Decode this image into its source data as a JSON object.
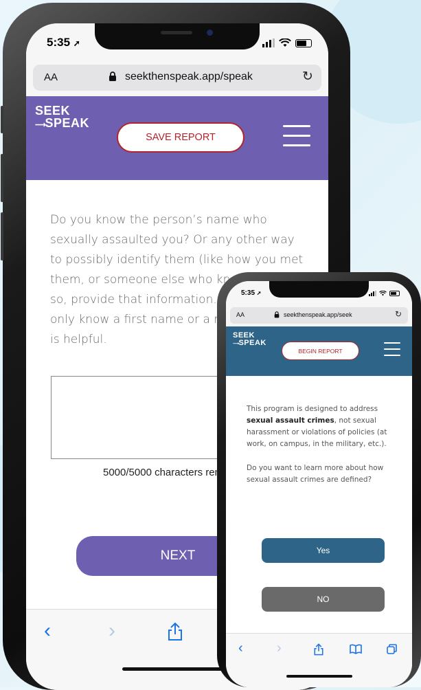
{
  "colors": {
    "big_header": "#6f5fb0",
    "small_header": "#2d6487",
    "save_text": "#b0252a",
    "no_button": "#6a6a6a"
  },
  "big_phone": {
    "status_time": "5:35",
    "url_aa": "AA",
    "url": "seekthenspeak.app/speak",
    "logo_line1": "SEEK",
    "logo_line2": "SPEAK",
    "save_button": "SAVE REPORT",
    "question": "Do you know the person’s name who sexually assaulted you? Or any other way to possibly identify them (like how you met them, or someone else who knows them)? If so, provide that information. Even if you only know a first name or a nickname, that is helpful.",
    "charcount": "5000/5000 characters remaining",
    "next_button": "NEXT",
    "icons": [
      "back-icon",
      "forward-icon",
      "share-icon",
      "bookmarks-icon",
      "tabs-icon"
    ]
  },
  "small_phone": {
    "status_time": "5:35",
    "url_aa": "AA",
    "url": "seekthenspeak.app/seek",
    "logo_line1": "SEEK",
    "logo_line2": "SPEAK",
    "begin_button": "BEGIN REPORT",
    "intro_pre": "This program is designed to address ",
    "intro_bold": "sexual assault crimes",
    "intro_post": ", not sexual harassment or violations of policies (at work, on campus, in the military, etc.).",
    "question": "Do you want to learn more about how sexual assault crimes are defined?",
    "yes_button": "Yes",
    "no_button": "NO"
  }
}
